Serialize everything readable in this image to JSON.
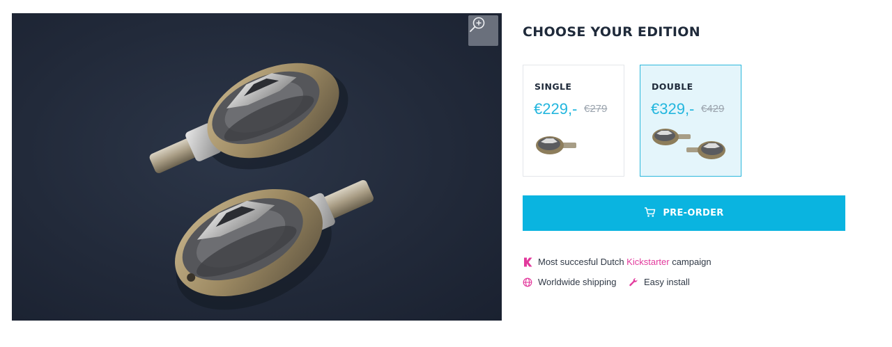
{
  "hero": {
    "zoom_icon": "zoom-in-icon",
    "background_color": "#252d3d"
  },
  "editions": {
    "title": "CHOOSE YOUR EDITION",
    "options": [
      {
        "name": "SINGLE",
        "price": "€229,-",
        "old_price": "€279",
        "selected": false,
        "image": "single-pedal"
      },
      {
        "name": "DOUBLE",
        "price": "€329,-",
        "old_price": "€429",
        "selected": true,
        "image": "pedal-pair"
      }
    ]
  },
  "preorder": {
    "label": "PRE-ORDER",
    "icon": "cart-icon",
    "color": "#0ab4e0"
  },
  "features": {
    "kickstarter": {
      "icon": "kickstarter-icon",
      "prefix": "Most succesful Dutch",
      "link": "Kickstarter",
      "suffix": "campaign"
    },
    "shipping": {
      "icon": "globe-icon",
      "label": "Worldwide shipping"
    },
    "install": {
      "icon": "wrench-icon",
      "label": "Easy install"
    }
  },
  "colors": {
    "accent": "#23b6de",
    "pink": "#e2399c",
    "heading": "#1f2a3a"
  }
}
